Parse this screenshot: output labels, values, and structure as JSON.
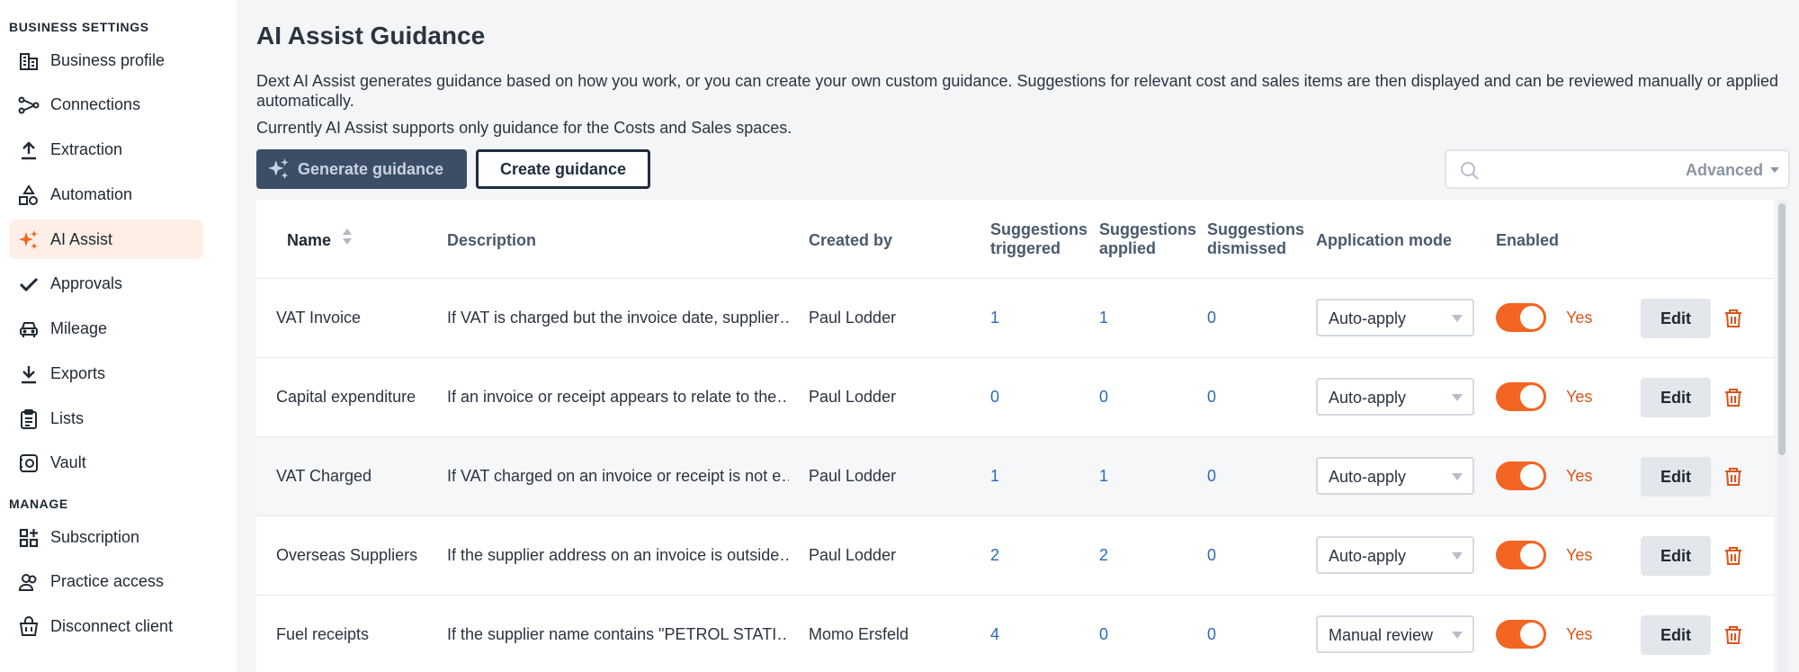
{
  "colors": {
    "accent": "#f26522",
    "primary_dark": "#3c4e66",
    "link": "#2a6bb8",
    "active_bg": "#fdeee6"
  },
  "sidebar": {
    "section_business": "BUSINESS SETTINGS",
    "section_manage": "MANAGE",
    "items": [
      {
        "label": "Business profile",
        "icon": "business-icon"
      },
      {
        "label": "Connections",
        "icon": "connections-icon"
      },
      {
        "label": "Extraction",
        "icon": "upload-icon"
      },
      {
        "label": "Automation",
        "icon": "shapes-icon"
      },
      {
        "label": "AI Assist",
        "icon": "sparkle-icon",
        "active": true
      },
      {
        "label": "Approvals",
        "icon": "check-icon"
      },
      {
        "label": "Mileage",
        "icon": "car-icon"
      },
      {
        "label": "Exports",
        "icon": "download-icon"
      },
      {
        "label": "Lists",
        "icon": "clipboard-icon"
      },
      {
        "label": "Vault",
        "icon": "vault-icon"
      }
    ],
    "manage_items": [
      {
        "label": "Subscription",
        "icon": "apps-icon"
      },
      {
        "label": "Practice access",
        "icon": "users-icon"
      },
      {
        "label": "Disconnect client",
        "icon": "basket-icon"
      }
    ]
  },
  "main": {
    "title": "AI Assist Guidance",
    "description": "Dext AI Assist generates guidance based on how you work, or you can create your own custom guidance. Suggestions for relevant cost and sales items are then displayed and can be reviewed manually or applied automatically.",
    "description2": "Currently AI Assist supports only guidance for the Costs and Sales spaces.",
    "generate_label": "Generate guidance",
    "create_label": "Create guidance",
    "search_placeholder": "",
    "advanced_label": "Advanced"
  },
  "table": {
    "columns": {
      "name": "Name",
      "description": "Description",
      "created_by": "Created by",
      "triggered_1": "Suggestions",
      "triggered_2": "triggered",
      "applied_1": "Suggestions",
      "applied_2": "applied",
      "dismissed_1": "Suggestions",
      "dismissed_2": "dismissed",
      "mode": "Application mode",
      "enabled": "Enabled"
    },
    "rows": [
      {
        "name": "VAT Invoice",
        "description": "If VAT is charged but the invoice date, supplier…",
        "created_by": "Paul Lodder",
        "triggered": "1",
        "applied": "1",
        "dismissed": "0",
        "mode": "Auto-apply",
        "enabled": "Yes",
        "edit": "Edit"
      },
      {
        "name": "Capital expenditure",
        "description": "If an invoice or receipt appears to relate to the…",
        "created_by": "Paul Lodder",
        "triggered": "0",
        "applied": "0",
        "dismissed": "0",
        "mode": "Auto-apply",
        "enabled": "Yes",
        "edit": "Edit"
      },
      {
        "name": "VAT Charged",
        "description": "If VAT charged on an invoice or receipt is not e…",
        "created_by": "Paul Lodder",
        "triggered": "1",
        "applied": "1",
        "dismissed": "0",
        "mode": "Auto-apply",
        "enabled": "Yes",
        "edit": "Edit"
      },
      {
        "name": "Overseas Suppliers",
        "description": "If the supplier address on an invoice is outside…",
        "created_by": "Paul Lodder",
        "triggered": "2",
        "applied": "2",
        "dismissed": "0",
        "mode": "Auto-apply",
        "enabled": "Yes",
        "edit": "Edit"
      },
      {
        "name": "Fuel receipts",
        "description": "If the supplier name contains \"PETROL STATI…",
        "created_by": "Momo Ersfeld",
        "triggered": "4",
        "applied": "0",
        "dismissed": "0",
        "mode": "Manual review",
        "enabled": "Yes",
        "edit": "Edit"
      }
    ]
  }
}
